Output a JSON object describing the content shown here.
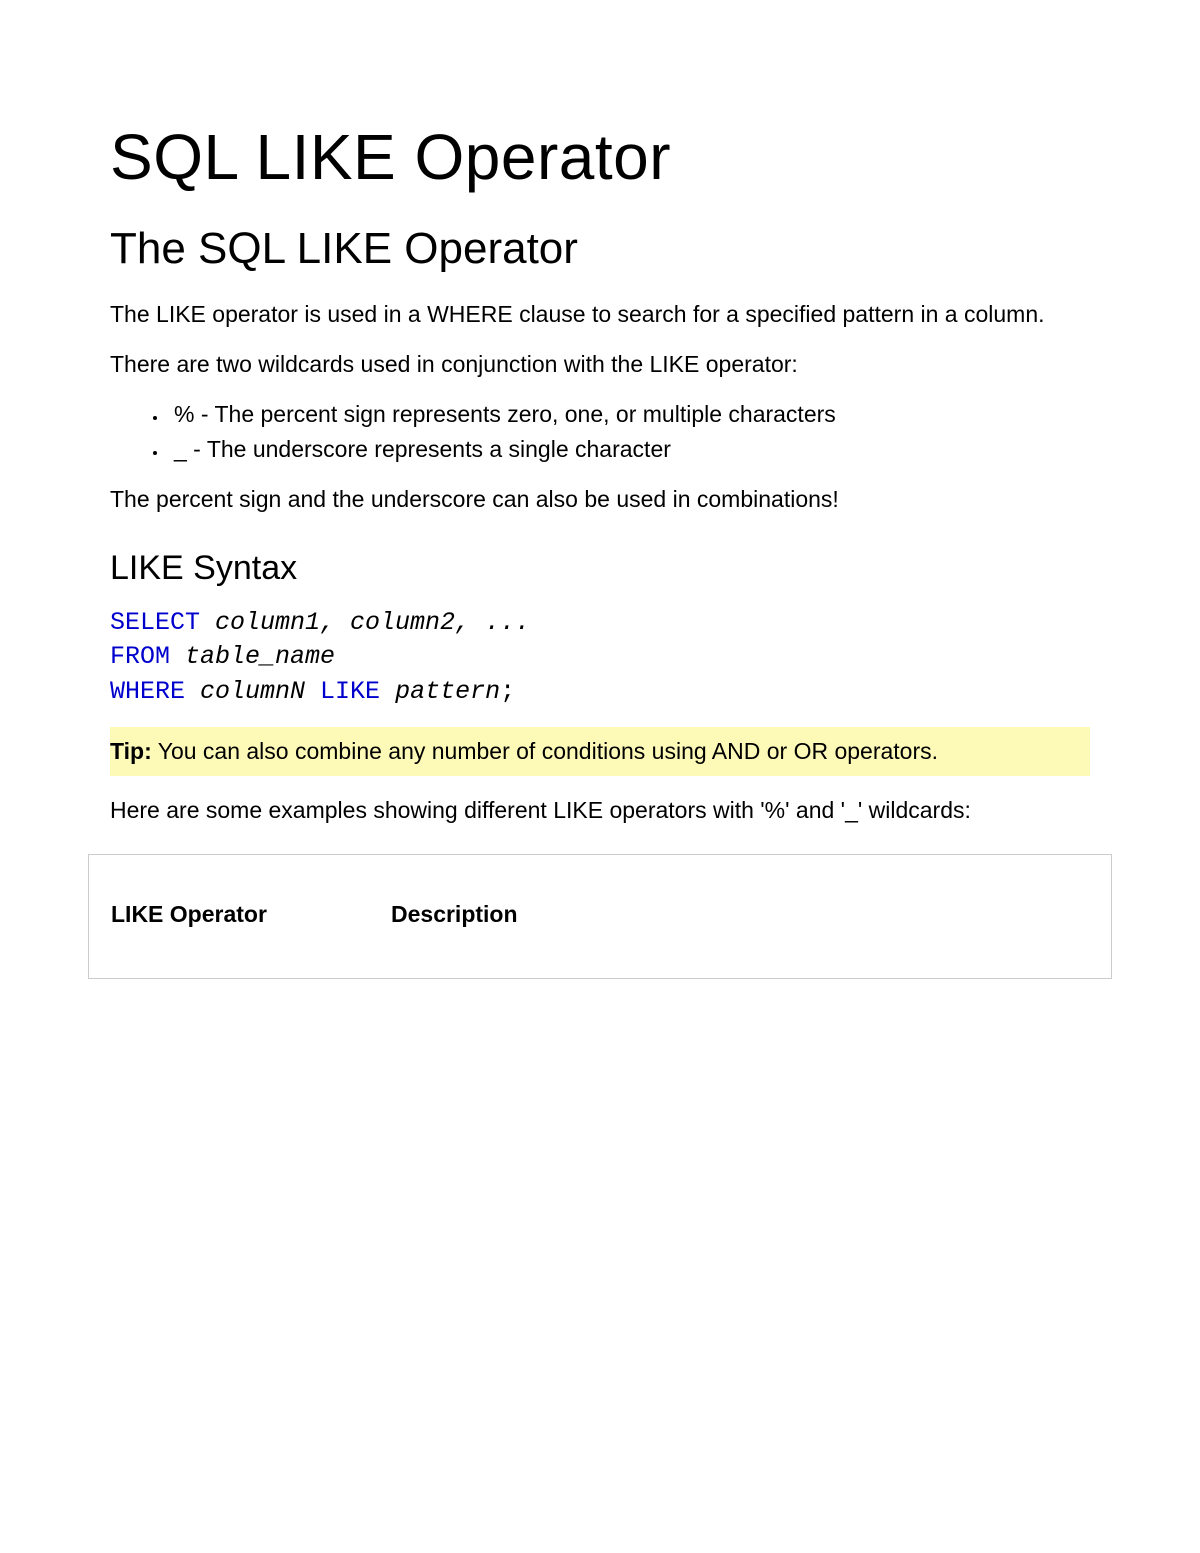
{
  "title": "SQL LIKE Operator",
  "subtitle": "The SQL LIKE Operator",
  "intro_p1": "The LIKE operator is used in a WHERE clause to search for a specified pattern in a column.",
  "intro_p2": "There are two wildcards used in conjunction with the LIKE operator:",
  "bullets": {
    "b1": "% - The percent sign represents zero, one, or multiple characters",
    "b2": "_ - The underscore represents a single character"
  },
  "intro_p3": "The percent sign and the underscore can also be used in combinations!",
  "syntax_heading": "LIKE Syntax",
  "code": {
    "select": "SELECT",
    "select_args": " column1, column2, ...",
    "from": "FROM",
    "from_args": " table_name",
    "where": "WHERE",
    "where_col": " columnN ",
    "like": "LIKE",
    "like_args": " pattern",
    "semi": ";"
  },
  "tip_label": "Tip:",
  "tip_text": " You can also combine any number of conditions using AND or OR operators.",
  "examples_intro": "Here are some examples showing different LIKE operators with '%' and '_' wildcards:",
  "table": {
    "col1": "LIKE Operator",
    "col2": "Description"
  }
}
